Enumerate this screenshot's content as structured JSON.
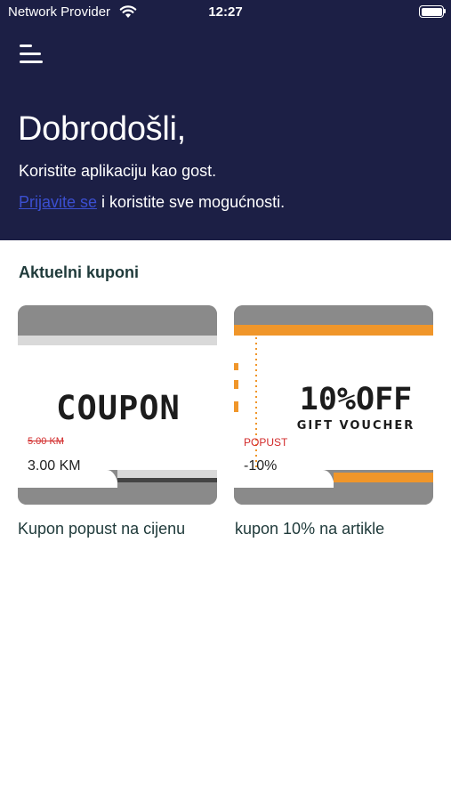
{
  "status_bar": {
    "carrier": "Network Provider",
    "time": "12:27",
    "wifi_icon": "wifi-icon",
    "battery_icon": "battery-icon"
  },
  "header": {
    "menu_icon": "hamburger-menu-icon",
    "welcome_title": "Dobrodošli,",
    "guest_text": "Koristite aplikaciju kao gost.",
    "login_link": "Prijavite se",
    "login_suffix": " i koristite sve mogućnosti."
  },
  "coupons_section": {
    "title": "Aktuelni kuponi",
    "coupons": [
      {
        "image_text": "COUPON",
        "old_price": "5.00 KM",
        "price": "3.00 KM",
        "name": "Kupon popust na cijenu"
      },
      {
        "image_text": "10%OFF",
        "image_subtext": "GIFT VOUCHER",
        "label": "POPUST",
        "price": "-10%",
        "name": "kupon 10% na artikle"
      }
    ]
  },
  "colors": {
    "header_bg": "#1c1f45",
    "link": "#3b4fd1",
    "discount_red": "#d22b2b",
    "accent_orange": "#f0962a",
    "text_dark": "#1f3a3a"
  }
}
